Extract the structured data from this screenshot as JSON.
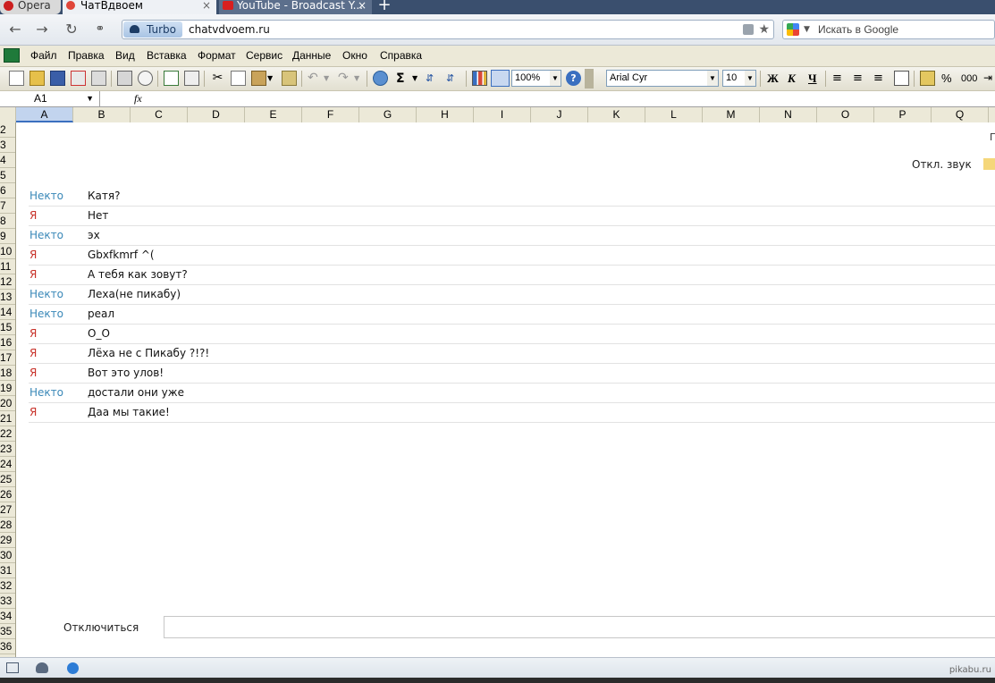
{
  "browser": {
    "tabs": [
      {
        "label": "Opera",
        "active": false
      },
      {
        "label": "ЧатВдвоем",
        "active": true
      },
      {
        "label": "YouTube - Broadcast Y...",
        "active": false
      }
    ],
    "close_glyph": "×",
    "new_tab_glyph": "+",
    "turbo_label": "Turbo",
    "url": "chatvdvoem.ru",
    "search_placeholder": "Искать в Google"
  },
  "excel": {
    "menu": [
      "Файл",
      "Правка",
      "Вид",
      "Вставка",
      "Формат",
      "Сервис",
      "Данные",
      "Окно",
      "Справка"
    ],
    "zoom": "100%",
    "font_name": "Arial Cyr",
    "font_size": "10",
    "bold_label": "Ж",
    "italic_label": "К",
    "underline_label": "Ч",
    "sigma": "Σ",
    "percent": "%",
    "thousands": "000",
    "name_box": "A1",
    "fx": "fx",
    "columns": [
      "A",
      "B",
      "C",
      "D",
      "E",
      "F",
      "G",
      "H",
      "I",
      "J",
      "K",
      "L",
      "M",
      "N",
      "O",
      "P",
      "Q"
    ],
    "rows": [
      "2",
      "3",
      "4",
      "5",
      "6",
      "7",
      "8",
      "9",
      "10",
      "11",
      "12",
      "13",
      "14",
      "15",
      "16",
      "17",
      "18",
      "19",
      "20",
      "21",
      "22",
      "23",
      "24",
      "25",
      "26",
      "27",
      "28",
      "29",
      "30",
      "31",
      "32",
      "33",
      "34",
      "35",
      "36"
    ]
  },
  "chat": {
    "clipped_label": "П",
    "mute_label": "Откл. звук",
    "messages": [
      {
        "who": "Некто",
        "role": "stranger",
        "text": "Катя?"
      },
      {
        "who": "Я",
        "role": "me",
        "text": "Нет"
      },
      {
        "who": "Некто",
        "role": "stranger",
        "text": "эх"
      },
      {
        "who": "Я",
        "role": "me",
        "text": "Gbxfkmrf ^("
      },
      {
        "who": "Я",
        "role": "me",
        "text": "А тебя как зовут?"
      },
      {
        "who": "Некто",
        "role": "stranger",
        "text": "Леха(не пикабу)"
      },
      {
        "who": "Некто",
        "role": "stranger",
        "text": "реал"
      },
      {
        "who": "Я",
        "role": "me",
        "text": "О_О"
      },
      {
        "who": "Я",
        "role": "me",
        "text": "Лёха не с Пикабу ?!?!"
      },
      {
        "who": "Я",
        "role": "me",
        "text": "Вот это улов!"
      },
      {
        "who": "Некто",
        "role": "stranger",
        "text": "достали они уже"
      },
      {
        "who": "Я",
        "role": "me",
        "text": "Даа мы такие!"
      }
    ],
    "disconnect_label": "Отключиться",
    "input_value": ""
  },
  "watermark": "pikabu.ru",
  "colors": {
    "stranger": "#3a88b8",
    "me": "#c8322a",
    "mute_toggle": "#f5d77a"
  }
}
